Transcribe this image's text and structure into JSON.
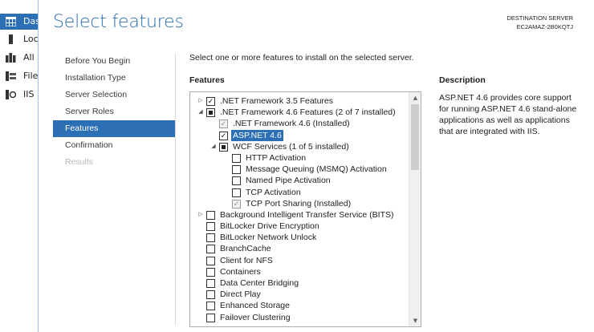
{
  "background_app": {
    "items": [
      {
        "label": "Dashboard",
        "icon": "dashboard-grid-icon",
        "active": true
      },
      {
        "label": "Local Server",
        "icon": "server-icon",
        "active": false
      },
      {
        "label": "All Servers",
        "icon": "servers-icon",
        "active": false
      },
      {
        "label": "File and Storage Services",
        "icon": "file-services-icon",
        "active": false
      },
      {
        "label": "IIS",
        "icon": "iis-icon",
        "active": false
      }
    ]
  },
  "wizard": {
    "title": "Select features",
    "destination": {
      "label": "DESTINATION SERVER",
      "server": "EC2AMAZ-2B0KQTJ"
    },
    "nav": [
      {
        "label": "Before You Begin",
        "state": "normal"
      },
      {
        "label": "Installation Type",
        "state": "normal"
      },
      {
        "label": "Server Selection",
        "state": "normal"
      },
      {
        "label": "Server Roles",
        "state": "normal"
      },
      {
        "label": "Features",
        "state": "active"
      },
      {
        "label": "Confirmation",
        "state": "normal"
      },
      {
        "label": "Results",
        "state": "disabled"
      }
    ],
    "intro": "Select one or more features to install on the selected server.",
    "features_header": "Features",
    "description_header": "Description",
    "description": "ASP.NET 4.6 provides core support for running ASP.NET 4.6 stand-alone applications as well as applications that are integrated with IIS."
  },
  "features": [
    {
      "label": ".NET Framework 3.5 Features",
      "level": 0,
      "expander": "collapsed",
      "check": "checked"
    },
    {
      "label": ".NET Framework 4.6 Features (2 of 7 installed)",
      "level": 0,
      "expander": "expanded",
      "check": "partial"
    },
    {
      "label": ".NET Framework 4.6 (Installed)",
      "level": 1,
      "expander": "none",
      "check": "checked-disabled"
    },
    {
      "label": "ASP.NET 4.6",
      "level": 1,
      "expander": "none",
      "check": "checked",
      "selected": true
    },
    {
      "label": "WCF Services (1 of 5 installed)",
      "level": 1,
      "expander": "expanded",
      "check": "partial"
    },
    {
      "label": "HTTP Activation",
      "level": 2,
      "expander": "none",
      "check": "unchecked"
    },
    {
      "label": "Message Queuing (MSMQ) Activation",
      "level": 2,
      "expander": "none",
      "check": "unchecked"
    },
    {
      "label": "Named Pipe Activation",
      "level": 2,
      "expander": "none",
      "check": "unchecked"
    },
    {
      "label": "TCP Activation",
      "level": 2,
      "expander": "none",
      "check": "unchecked"
    },
    {
      "label": "TCP Port Sharing (Installed)",
      "level": 2,
      "expander": "none",
      "check": "checked-disabled"
    },
    {
      "label": "Background Intelligent Transfer Service (BITS)",
      "level": 0,
      "expander": "collapsed",
      "check": "unchecked"
    },
    {
      "label": "BitLocker Drive Encryption",
      "level": 0,
      "expander": "none",
      "check": "unchecked"
    },
    {
      "label": "BitLocker Network Unlock",
      "level": 0,
      "expander": "none",
      "check": "unchecked"
    },
    {
      "label": "BranchCache",
      "level": 0,
      "expander": "none",
      "check": "unchecked"
    },
    {
      "label": "Client for NFS",
      "level": 0,
      "expander": "none",
      "check": "unchecked"
    },
    {
      "label": "Containers",
      "level": 0,
      "expander": "none",
      "check": "unchecked"
    },
    {
      "label": "Data Center Bridging",
      "level": 0,
      "expander": "none",
      "check": "unchecked"
    },
    {
      "label": "Direct Play",
      "level": 0,
      "expander": "none",
      "check": "unchecked"
    },
    {
      "label": "Enhanced Storage",
      "level": 0,
      "expander": "none",
      "check": "unchecked"
    },
    {
      "label": "Failover Clustering",
      "level": 0,
      "expander": "none",
      "check": "unchecked"
    }
  ],
  "colors": {
    "accent": "#2d6fb5",
    "title": "#2a6db2"
  }
}
